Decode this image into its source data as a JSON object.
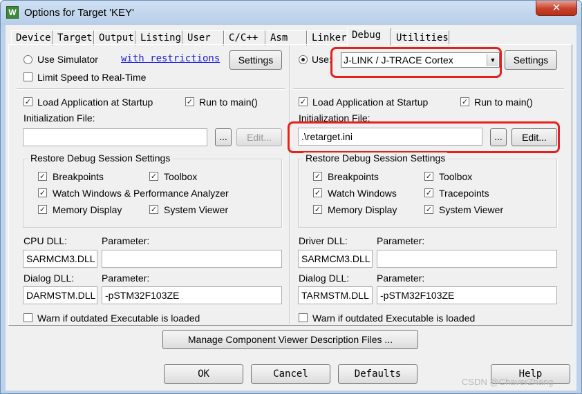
{
  "window": {
    "title": "Options for Target 'KEY'",
    "app_icon": "W",
    "close_glyph": "✕"
  },
  "tabs": [
    {
      "label": "Device"
    },
    {
      "label": "Target"
    },
    {
      "label": "Output"
    },
    {
      "label": "Listing"
    },
    {
      "label": "User"
    },
    {
      "label": "C/C++"
    },
    {
      "label": "Asm"
    },
    {
      "label": "Linker"
    },
    {
      "label": "Debug",
      "active": true
    },
    {
      "label": "Utilities"
    }
  ],
  "left": {
    "use_simulator": "Use Simulator",
    "with_restrictions": "with restrictions",
    "settings": "Settings",
    "limit_speed": "Limit Speed to Real-Time",
    "load_app": "Load Application at Startup",
    "run_to_main": "Run to main()",
    "init_file_label": "Initialization File:",
    "init_file_value": "",
    "browse": "...",
    "edit": "Edit...",
    "restore_group": "Restore Debug Session Settings",
    "breakpoints": "Breakpoints",
    "toolbox": "Toolbox",
    "watch_windows": "Watch Windows & Performance Analyzer",
    "memory_display": "Memory Display",
    "system_viewer": "System Viewer",
    "cpu_dll_label": "CPU DLL:",
    "cpu_dll_value": "SARMCM3.DLL",
    "parameter_label": "Parameter:",
    "cpu_param_value": "",
    "dialog_dll_label": "Dialog DLL:",
    "dialog_dll_value": "DARMSTM.DLL",
    "dialog_param_value": "-pSTM32F103ZE",
    "warn_outdated": "Warn if outdated Executable is loaded"
  },
  "right": {
    "use": "Use:",
    "driver_selected": "J-LINK / J-TRACE Cortex",
    "settings": "Settings",
    "load_app": "Load Application at Startup",
    "run_to_main": "Run to main()",
    "init_file_label": "Initialization File:",
    "init_file_value": ".\\retarget.ini",
    "browse": "...",
    "edit": "Edit...",
    "restore_group": "Restore Debug Session Settings",
    "breakpoints": "Breakpoints",
    "toolbox": "Toolbox",
    "watch_windows": "Watch Windows",
    "tracepoints": "Tracepoints",
    "memory_display": "Memory Display",
    "system_viewer": "System Viewer",
    "driver_dll_label": "Driver DLL:",
    "driver_dll_value": "SARMCM3.DLL",
    "parameter_label": "Parameter:",
    "driver_param_value": "",
    "dialog_dll_label": "Dialog DLL:",
    "dialog_dll_value": "TARMSTM.DLL",
    "dialog_param_value": "-pSTM32F103ZE",
    "warn_outdated": "Warn if outdated Executable is loaded"
  },
  "manage_button": "Manage Component Viewer Description Files ...",
  "footer": {
    "ok": "OK",
    "cancel": "Cancel",
    "defaults": "Defaults",
    "help": "Help"
  },
  "watermark": "CSDN @ChaverZhang",
  "check_glyph": "✓",
  "colors": {
    "highlight": "#e8201c",
    "link": "#1a1ae6",
    "dialog_bg": "#f0f0f0"
  }
}
